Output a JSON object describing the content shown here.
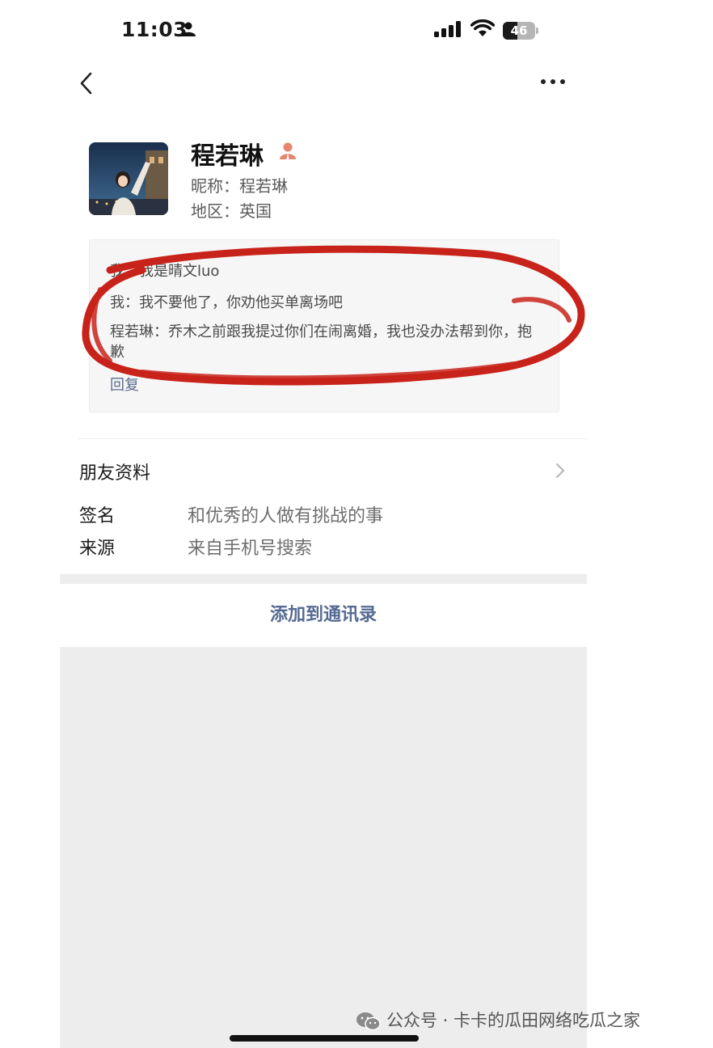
{
  "status_bar": {
    "time": "11:03",
    "battery": "46",
    "battery_level": 0.46
  },
  "profile": {
    "name": "程若琳",
    "nickname": "昵称：程若琳",
    "region": "地区：英国"
  },
  "messages": [
    "我：我是晴文luo",
    "我：我不要他了，你劝他买单离场吧",
    "程若琳：乔木之前跟我提过你们在闹离婚，我也没办法帮到你，抱歉"
  ],
  "reply_label": "回复",
  "friend_info": {
    "label": "朋友资料",
    "signature_label": "签名",
    "signature_value": "和优秀的人做有挑战的事",
    "source_label": "来源",
    "source_value": "来自手机号搜索"
  },
  "add_button": "添加到通讯录",
  "watermark": "公众号 · 卡卡的瓜田网络吃瓜之家",
  "colors": {
    "annotation_red": "#c8231a",
    "link_blue": "#566b93",
    "gray_bg": "#ededed"
  }
}
